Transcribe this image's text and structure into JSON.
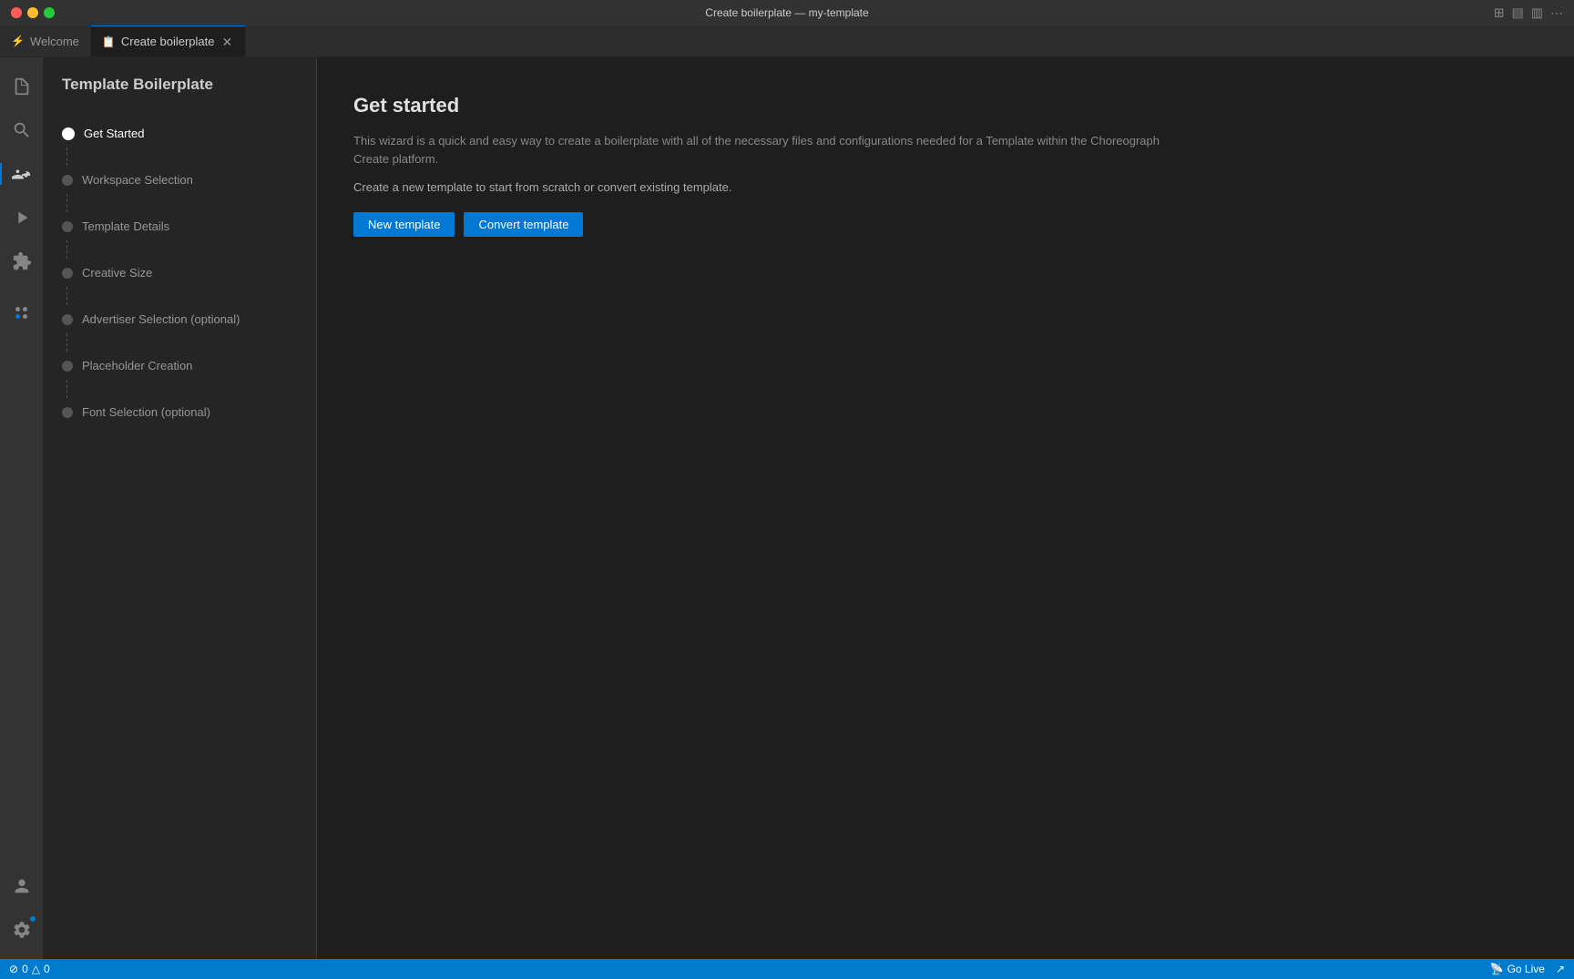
{
  "titlebar": {
    "title": "Create boilerplate — my-template"
  },
  "tabs": [
    {
      "id": "welcome",
      "label": "Welcome",
      "icon": "⚡",
      "active": false,
      "closeable": false
    },
    {
      "id": "create-boilerplate",
      "label": "Create boilerplate",
      "icon": "📄",
      "active": true,
      "closeable": true
    }
  ],
  "sidebar": {
    "title": "Template Boilerplate"
  },
  "steps": [
    {
      "id": "get-started",
      "label": "Get Started",
      "active": true,
      "has_connector": true
    },
    {
      "id": "workspace-selection",
      "label": "Workspace Selection",
      "active": false,
      "has_connector": true
    },
    {
      "id": "template-details",
      "label": "Template Details",
      "active": false,
      "has_connector": true
    },
    {
      "id": "creative-size",
      "label": "Creative Size",
      "active": false,
      "has_connector": true
    },
    {
      "id": "advertiser-selection",
      "label": "Advertiser Selection (optional)",
      "active": false,
      "has_connector": true
    },
    {
      "id": "placeholder-creation",
      "label": "Placeholder Creation",
      "active": false,
      "has_connector": true
    },
    {
      "id": "font-selection",
      "label": "Font Selection (optional)",
      "active": false,
      "has_connector": false
    }
  ],
  "main": {
    "heading": "Get started",
    "description": "This wizard is a quick and easy way to create a boilerplate with all of the necessary files and configurations needed for a Template within the Choreograph Create platform.",
    "sub_text": "Create a new template to start from scratch or convert existing template.",
    "new_template_label": "New template",
    "convert_template_label": "Convert template"
  },
  "status_bar": {
    "left_items": [
      "⊘",
      "0",
      "△",
      "0"
    ],
    "go_live_label": "Go Live",
    "right_icon": "↗"
  }
}
